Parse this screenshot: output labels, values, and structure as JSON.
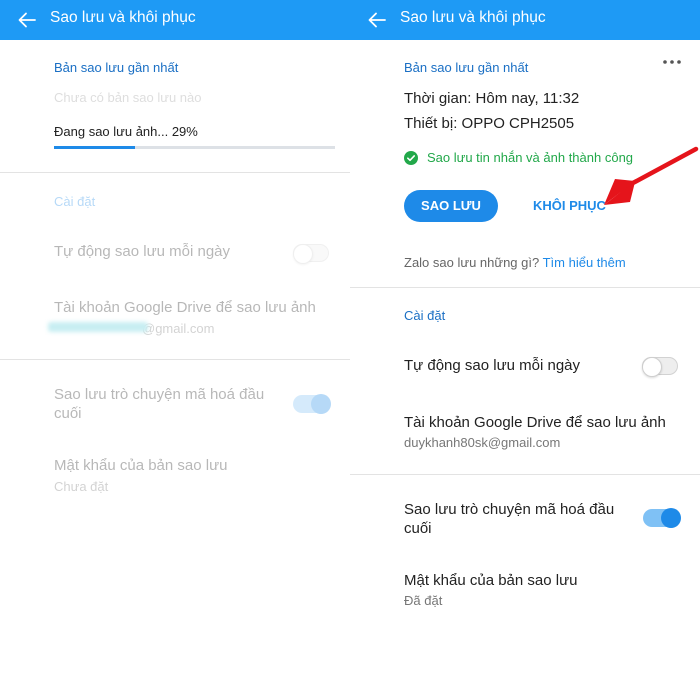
{
  "left": {
    "header": {
      "title": "Sao lưu và khôi phục"
    },
    "latest_backup": {
      "section_title": "Bản sao lưu gần nhất",
      "status_text": "Chưa có bản sao lưu nào",
      "progress_label": "Đang sao lưu ảnh... 29%",
      "progress_value": 0.29
    },
    "settings": {
      "section_title": "Cài đặt",
      "auto_backup_label": "Tự động sao lưu mỗi ngày",
      "auto_backup_on": false,
      "drive_label": "Tài khoản Google Drive để sao lưu ảnh",
      "drive_email_visible": "@gmail.com"
    },
    "encryption": {
      "e2ee_label_line1": "Sao lưu trò chuyện mã hoá đầu",
      "e2ee_label_line2": "cuối",
      "e2ee_on": true,
      "password_label": "Mật khẩu của bản sao lưu",
      "password_status": "Chưa đặt"
    }
  },
  "right": {
    "header": {
      "title": "Sao lưu và khôi phục"
    },
    "latest_backup": {
      "section_title": "Bản sao lưu gần nhất",
      "time_label": "Thời gian: Hôm nay, 11:32",
      "device_label": "Thiết bị: OPPO CPH2505",
      "success_text": "Sao lưu tin nhắn và ảnh thành công",
      "backup_button": "SAO LƯU",
      "restore_button": "KHÔI PHỤC",
      "info_text": "Zalo sao lưu những gì?",
      "info_link": "Tìm hiểu thêm"
    },
    "settings": {
      "section_title": "Cài đặt",
      "auto_backup_label": "Tự động sao lưu mỗi ngày",
      "auto_backup_on": false,
      "drive_label": "Tài khoản Google Drive để sao lưu ảnh",
      "drive_email": "duykhanh80sk@gmail.com"
    },
    "encryption": {
      "e2ee_label_line1": "Sao lưu trò chuyện mã hoá đầu",
      "e2ee_label_line2": "cuối",
      "e2ee_on": true,
      "password_label": "Mật khẩu của bản sao lưu",
      "password_status": "Đã đặt"
    }
  },
  "icons": {
    "back": "arrow-left-icon",
    "more": "more-horizontal-icon",
    "success": "check-circle-icon",
    "annotation": "red-arrow-icon"
  },
  "colors": {
    "header_bg": "#1e9af5",
    "accent": "#1e8ae8",
    "section_title": "#1a6fc4",
    "success": "#22a84a",
    "annotation": "#e5141b"
  }
}
